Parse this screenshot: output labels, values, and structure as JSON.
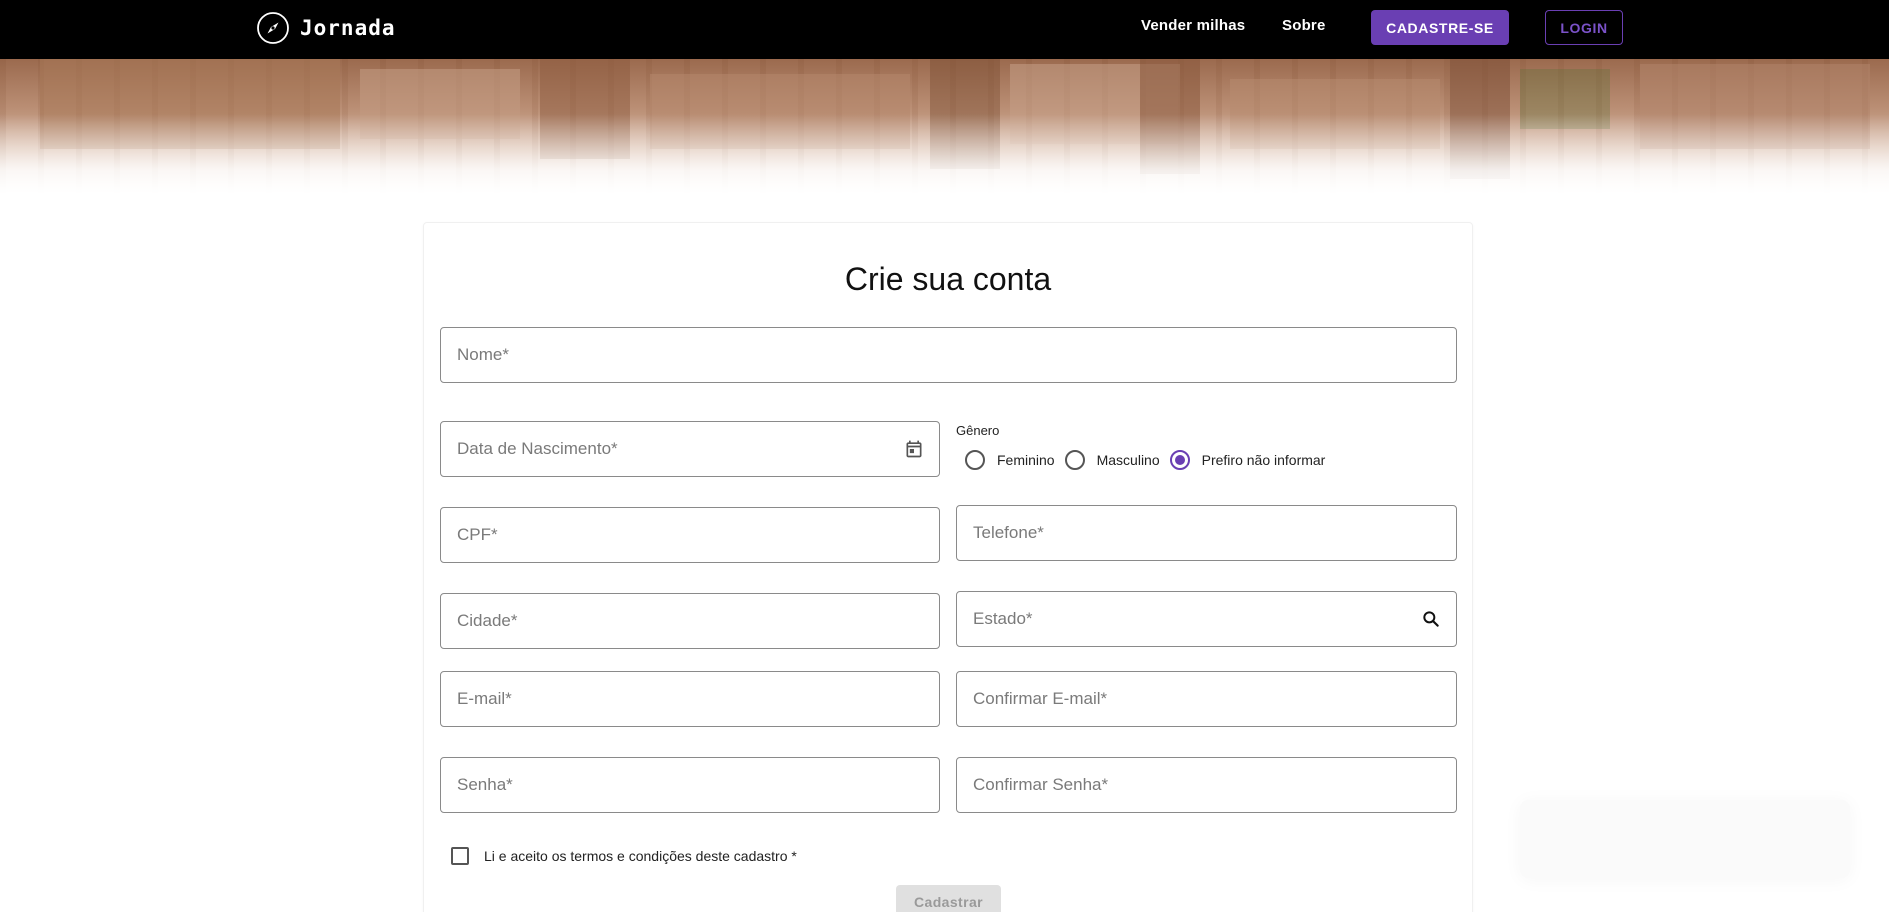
{
  "header": {
    "brand_name": "Jornada",
    "nav": {
      "sell_miles": "Vender milhas",
      "about": "Sobre"
    },
    "signup_button": "CADASTRE-SE",
    "login_button": "LOGIN"
  },
  "form": {
    "title": "Crie sua conta",
    "fields": {
      "name": "Nome*",
      "birth_date": "Data de Nascimento*",
      "cpf": "CPF*",
      "phone": "Telefone*",
      "city": "Cidade*",
      "state": "Estado*",
      "email": "E-mail*",
      "confirm_email": "Confirmar E-mail*",
      "password": "Senha*",
      "confirm_password": "Confirmar Senha*"
    },
    "gender": {
      "label": "Gênero",
      "options": [
        "Feminino",
        "Masculino",
        "Prefiro não informar"
      ],
      "selected": "Prefiro não informar"
    },
    "terms_label": "Li e aceito os termos e condições deste cadastro *",
    "submit_button": "Cadastrar"
  },
  "colors": {
    "accent": "#6a3fb3",
    "header_bg": "#000000",
    "input_border": "#8a8a8a",
    "disabled_button_bg": "#e0e0e0"
  },
  "icons": {
    "brand": "compass-icon",
    "birth_date": "calendar-icon",
    "state": "search-icon"
  }
}
